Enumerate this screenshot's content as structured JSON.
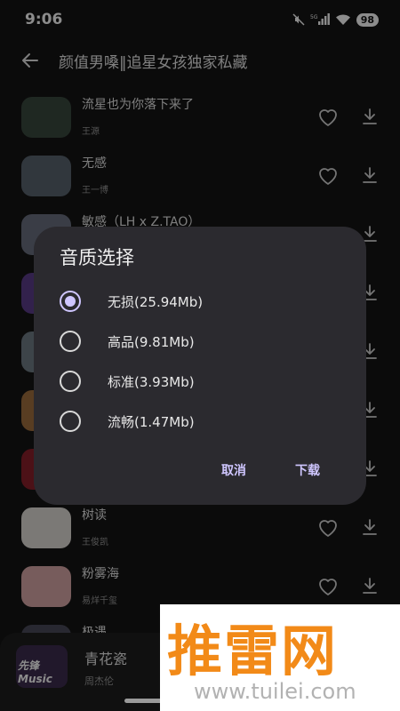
{
  "status_bar": {
    "time": "9:06",
    "network": "5G",
    "battery": "98"
  },
  "header": {
    "title": "颜值男嗓‖追星女孩独家私藏"
  },
  "songs": [
    {
      "title": "流星也为你落下来了",
      "artist": "王源"
    },
    {
      "title": "无感",
      "artist": "王一博"
    },
    {
      "title": "敏感（LH x Z.TAO）",
      "artist": ""
    },
    {
      "title": "",
      "artist": ""
    },
    {
      "title": "",
      "artist": ""
    },
    {
      "title": "",
      "artist": ""
    },
    {
      "title": "",
      "artist": ""
    },
    {
      "title": "树读",
      "artist": "王俊凯"
    },
    {
      "title": "粉雾海",
      "artist": "易烊千玺"
    },
    {
      "title": "极遇",
      "artist": ""
    }
  ],
  "dialog": {
    "title": "音质选择",
    "options": [
      {
        "label": "无损(25.94Mb)",
        "selected": true
      },
      {
        "label": "高品(9.81Mb)",
        "selected": false
      },
      {
        "label": "标准(3.93Mb)",
        "selected": false
      },
      {
        "label": "流畅(1.47Mb)",
        "selected": false
      }
    ],
    "cancel_label": "取消",
    "download_label": "下载"
  },
  "player": {
    "title": "青花瓷",
    "artist": "周杰伦",
    "cover_text": "先锋Music"
  },
  "watermark": {
    "brand": "推雷网",
    "url": "www.tuilei.com"
  },
  "colors": {
    "accent": "#cfc6ff",
    "background": "#141414",
    "dialog": "#2b2a2f",
    "watermark": "#f28a18"
  }
}
